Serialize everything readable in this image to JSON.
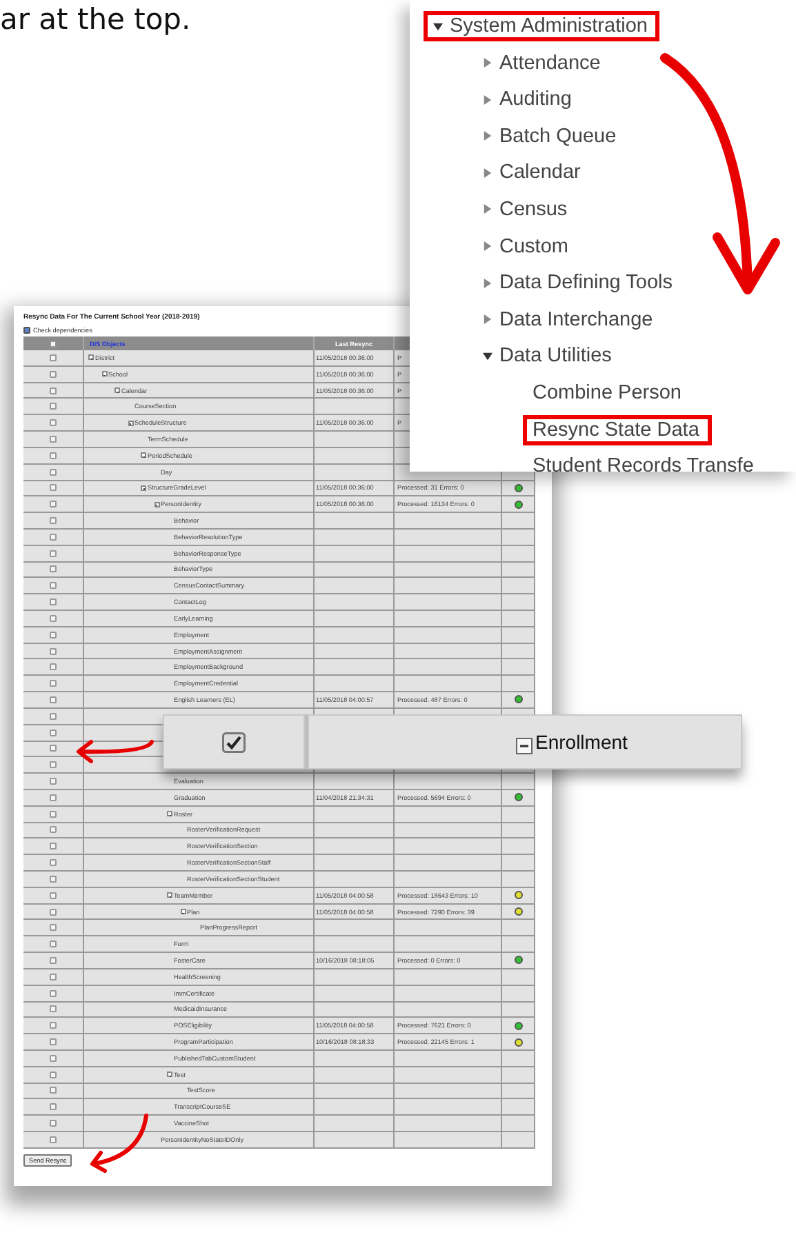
{
  "intro_text": "ar at the top.",
  "menu": {
    "items": [
      {
        "label": "System Administration",
        "expanded": true,
        "annotated": true,
        "children": [
          {
            "label": "Attendance",
            "expanded": false,
            "annotated": false
          },
          {
            "label": "Auditing",
            "expanded": false,
            "annotated": false
          },
          {
            "label": "Batch Queue",
            "expanded": false,
            "annotated": false
          },
          {
            "label": "Calendar",
            "expanded": false,
            "annotated": false
          },
          {
            "label": "Census",
            "expanded": false,
            "annotated": false
          },
          {
            "label": "Custom",
            "expanded": false,
            "annotated": false
          },
          {
            "label": "Data Defining Tools",
            "expanded": false,
            "annotated": false
          },
          {
            "label": "Data Interchange",
            "expanded": false,
            "annotated": false
          },
          {
            "label": "Data Utilities",
            "expanded": true,
            "annotated": false,
            "children": [
              {
                "label": "Combine Person",
                "annotated": false
              },
              {
                "label": "Resync State Data",
                "annotated": true
              },
              {
                "label": "Student Records Transfe",
                "annotated": false
              }
            ]
          }
        ]
      }
    ]
  },
  "resync": {
    "title": "Resync Data For The Current School Year (2018-2019)",
    "check_dependencies": {
      "label": "Check dependencies",
      "checked": true
    },
    "table": {
      "select_all": {
        "checked": false
      },
      "columns": [
        {
          "label": "DIS Objects",
          "kind": "link"
        },
        {
          "label": "Last Resync",
          "kind": "plain"
        }
      ],
      "rows": [
        {
          "name": "District",
          "checked": false,
          "last_resync": "11/05/2018 00:36:00",
          "status": "P",
          "children": [
            {
              "name": "School",
              "checked": false,
              "last_resync": "11/05/2018 00:36:00",
              "status": "P",
              "children": [
                {
                  "name": "Calendar",
                  "checked": false,
                  "last_resync": "11/05/2018 00:36:00",
                  "status": "P",
                  "children": [
                    {
                      "name": "CourseSection",
                      "checked": false
                    },
                    {
                      "name": "ScheduleStructure",
                      "checked": false,
                      "last_resync": "11/05/2018 00:36:00",
                      "status": "P",
                      "children": [
                        {
                          "name": "TermSchedule",
                          "checked": false
                        },
                        {
                          "name": "PeriodSchedule",
                          "checked": false,
                          "children": [
                            {
                              "name": "Day",
                              "checked": false
                            }
                          ]
                        },
                        {
                          "name": "StructureGradeLevel",
                          "checked": false,
                          "last_resync": "11/05/2018 00:36:00",
                          "status": "Processed: 31 Errors: 0",
                          "color": "#33c033",
                          "children": [
                            {
                              "name": "PersonIdentity",
                              "checked": false,
                              "last_resync": "11/05/2018 00:36:00",
                              "status": "Processed: 16134 Errors: 0",
                              "color": "#33c033",
                              "children": [
                                {
                                  "name": "Behavior",
                                  "checked": false
                                },
                                {
                                  "name": "BehaviorResolutionType",
                                  "checked": false
                                },
                                {
                                  "name": "BehaviorResponseType",
                                  "checked": false
                                },
                                {
                                  "name": "BehaviorType",
                                  "checked": false
                                },
                                {
                                  "name": "CensusContactSummary",
                                  "checked": false
                                },
                                {
                                  "name": "ContactLog",
                                  "checked": false
                                },
                                {
                                  "name": "EarlyLearning",
                                  "checked": false
                                },
                                {
                                  "name": "Employment",
                                  "checked": false
                                },
                                {
                                  "name": "EmploymentAssignment",
                                  "checked": false
                                },
                                {
                                  "name": "EmploymentBackground",
                                  "checked": false
                                },
                                {
                                  "name": "EmploymentCredential",
                                  "checked": false
                                },
                                {
                                  "name": "English Learners (EL)",
                                  "checked": false,
                                  "last_resync": "11/05/2018 04:00:57",
                                  "status": "Processed: 487 Errors: 0",
                                  "color": "#33c033"
                                },
                                {
                                  "checked": false
                                },
                                {
                                  "checked": false
                                },
                                {
                                  "checked": false
                                },
                                {
                                  "checked": false
                                },
                                {
                                  "name": "Evaluation",
                                  "checked": false
                                },
                                {
                                  "name": "Graduation",
                                  "checked": false,
                                  "last_resync": "11/04/2018 21:34:31",
                                  "status": "Processed: 5694 Errors: 0",
                                  "color": "#33c033"
                                },
                                {
                                  "name": "Roster",
                                  "checked": false,
                                  "children": [
                                    {
                                      "name": "RosterVerificationRequest",
                                      "checked": false
                                    },
                                    {
                                      "name": "RosterVerificationSection",
                                      "checked": false
                                    },
                                    {
                                      "name": "RosterVerificationSectionStaff",
                                      "checked": false
                                    },
                                    {
                                      "name": "RosterVerificationSectionStudent",
                                      "checked": false
                                    }
                                  ]
                                },
                                {
                                  "name": "TeamMember",
                                  "checked": false,
                                  "last_resync": "11/05/2018 04:00:58",
                                  "status": "Processed: 18643 Errors: 10",
                                  "color": "#e0e030",
                                  "children": [
                                    {
                                      "name": "Plan",
                                      "checked": false,
                                      "last_resync": "11/05/2018 04:00:58",
                                      "status": "Processed: 7290 Errors: 39",
                                      "color": "#e0e030",
                                      "children": [
                                        {
                                          "name": "PlanProgressReport",
                                          "checked": false
                                        }
                                      ]
                                    }
                                  ]
                                },
                                {
                                  "name": "Form",
                                  "checked": false
                                },
                                {
                                  "name": "FosterCare",
                                  "checked": false,
                                  "last_resync": "10/16/2018 08:18:05",
                                  "status": "Processed: 0 Errors: 0",
                                  "color": "#33c033"
                                },
                                {
                                  "name": "HealthScreening",
                                  "checked": false
                                },
                                {
                                  "name": "ImmCertificate",
                                  "checked": false
                                },
                                {
                                  "name": "MedicaidInsurance",
                                  "checked": false
                                },
                                {
                                  "name": "POSEligibility",
                                  "checked": false,
                                  "last_resync": "11/05/2018 04:00:58",
                                  "status": "Processed: 7621 Errors: 0",
                                  "color": "#33c033"
                                },
                                {
                                  "name": "ProgramParticipation",
                                  "checked": false,
                                  "last_resync": "10/16/2018 08:18:33",
                                  "status": "Processed: 22145 Errors: 1",
                                  "color": "#e0e030"
                                },
                                {
                                  "name": "PublishedTabCustomStudent",
                                  "checked": false
                                },
                                {
                                  "name": "Test",
                                  "checked": false,
                                  "children": [
                                    {
                                      "name": "TestScore",
                                      "checked": false
                                    }
                                  ]
                                },
                                {
                                  "name": "TranscriptCourseSE",
                                  "checked": false
                                },
                                {
                                  "name": "VaccineShot",
                                  "checked": false
                                }
                              ]
                            },
                            {
                              "name": "PersonIdentityNoStateIDOnly",
                              "checked": false
                            }
                          ]
                        }
                      ]
                    }
                  ]
                }
              ]
            }
          ]
        }
      ]
    },
    "send_button": "Send Resync"
  },
  "zoom_inset": {
    "checked": true,
    "expanded": true,
    "label": "Enrollment"
  }
}
